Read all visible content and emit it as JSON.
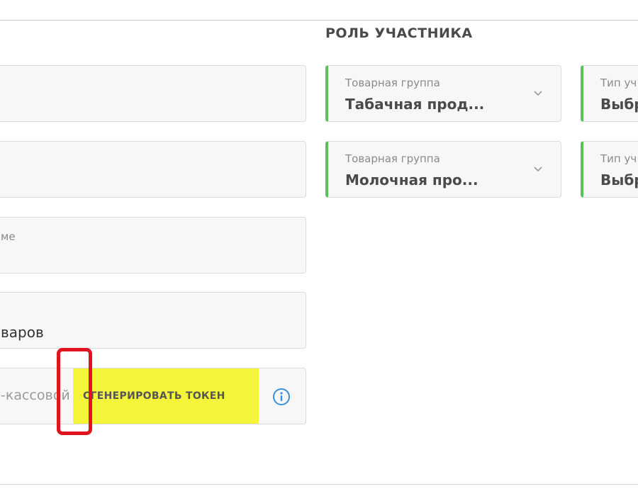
{
  "section": {
    "title": "РОЛЬ УЧАСТНИКА"
  },
  "left_fields": {
    "field3_label_fragment": "ме",
    "field4_value_fragment": "варов",
    "token_placeholder_fragment": "-кассовой",
    "generate_token_label": "СГЕНЕРИРОВАТЬ ТОКЕН"
  },
  "roles": [
    {
      "product_group_label": "Товарная группа",
      "product_group_value": "Табачная прод...",
      "participant_type_label": "Тип уч",
      "participant_type_value": "Выбр"
    },
    {
      "product_group_label": "Товарная группа",
      "product_group_value": "Молочная про...",
      "participant_type_label": "Тип уч",
      "participant_type_value": "Выбр"
    }
  ],
  "colors": {
    "accent_green": "#5ac05a",
    "highlight_yellow": "#f4f43a",
    "annotation_red": "#e0141e",
    "info_blue": "#3b8fd9"
  },
  "icons": {
    "info": "info-circle-icon",
    "chevron": "chevron-down-icon"
  }
}
